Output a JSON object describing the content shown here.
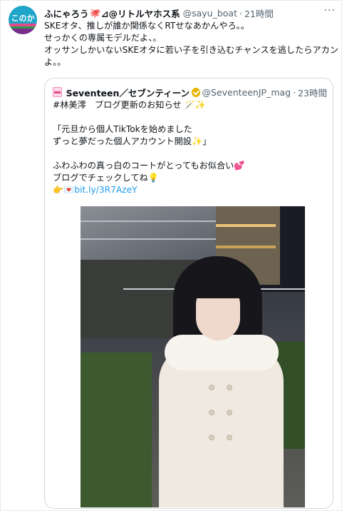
{
  "tweet": {
    "avatar_text": "このか",
    "display_name": "ふにゃろう",
    "display_name_suffix": "⊿@リトルヤホス系",
    "handle": "@sayu_boat",
    "separator": "·",
    "time": "21時間",
    "more_label": "···",
    "body_lines": [
      "SKEオタ、推しが誰か関係なくRTせなあかんやろ。。",
      "せっかくの専属モデルだよ、。",
      "オッサンしかいないSKEオタに若い子を引き込むチャンスを逃したらアカン",
      "よ。。"
    ]
  },
  "quote": {
    "name": "Seventeen／セブンティーン",
    "handle": "@SeventeenJP_mag",
    "separator": "·",
    "time": "23時間",
    "line1_hashtag": "#林美澪",
    "line1_text": "　ブログ更新のお知らせ",
    "line2": "",
    "line3": "「元旦から個人TikTokを始めました",
    "line4": "ずっと夢だった個人アカウント開設",
    "line4_end": "」",
    "line5": "",
    "line6": "ふわふわの真っ白のコートがとってもお似合い",
    "line7": "ブログでチェックしてね",
    "link": "bit.ly/3R7AzeY"
  },
  "colors": {
    "accent": "#1d9bf0",
    "muted": "#536471",
    "border": "#cfd9de",
    "avatar_bg": "#1ea5c9"
  },
  "icons": {
    "more": "more-horizontal-icon",
    "verified": "verified-gold-icon",
    "octopus": "octopus-emoji",
    "sparkle": "sparkles-emoji"
  }
}
